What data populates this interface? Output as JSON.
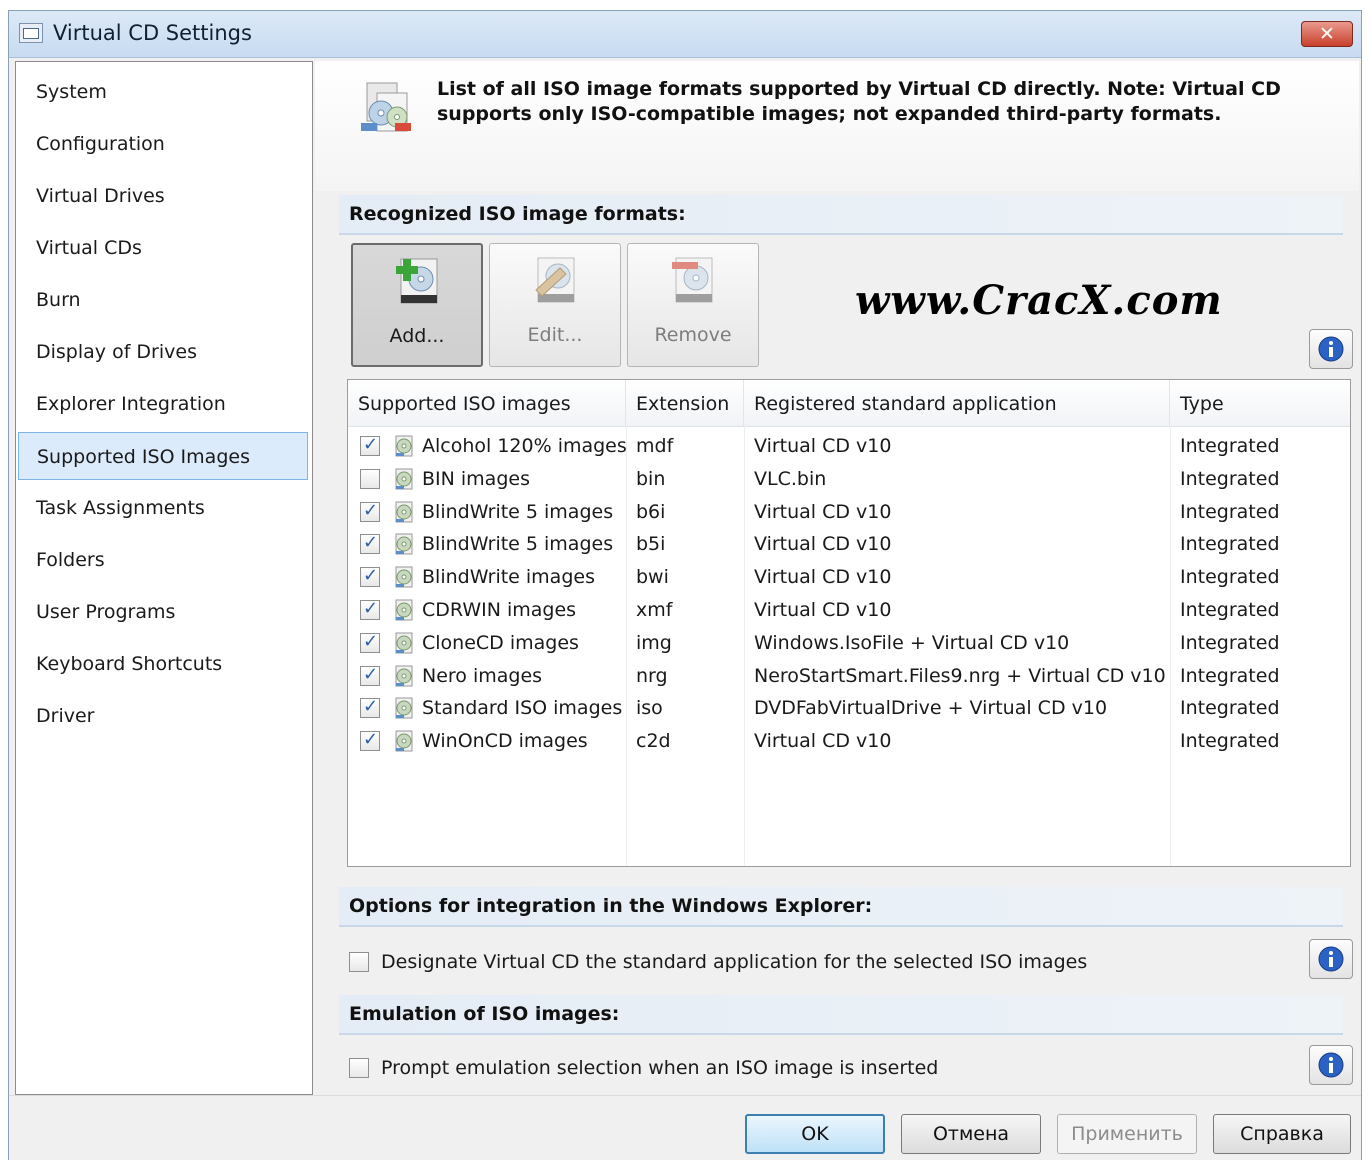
{
  "window": {
    "title": "Virtual CD Settings",
    "close_glyph": "✕"
  },
  "sidebar": {
    "items": [
      {
        "label": "System",
        "active": false
      },
      {
        "label": "Configuration",
        "active": false
      },
      {
        "label": "Virtual Drives",
        "active": false
      },
      {
        "label": "Virtual CDs",
        "active": false
      },
      {
        "label": "Burn",
        "active": false
      },
      {
        "label": "Display of Drives",
        "active": false
      },
      {
        "label": "Explorer Integration",
        "active": false
      },
      {
        "label": "Supported ISO Images",
        "active": true
      },
      {
        "label": "Task Assignments",
        "active": false
      },
      {
        "label": "Folders",
        "active": false
      },
      {
        "label": "User Programs",
        "active": false
      },
      {
        "label": "Keyboard Shortcuts",
        "active": false
      },
      {
        "label": "Driver",
        "active": false
      }
    ]
  },
  "banner": {
    "text": "List of all ISO image formats supported by Virtual CD directly. Note: Virtual CD supports only ISO-compatible images; not expanded third-party formats."
  },
  "recognized": {
    "header": "Recognized ISO image formats:",
    "buttons": {
      "add": "Add...",
      "edit": "Edit...",
      "remove": "Remove"
    },
    "watermark": "www.CracX.com",
    "columns": [
      "Supported ISO images",
      "Extension",
      "Registered standard application",
      "Type"
    ],
    "rows": [
      {
        "checked": true,
        "name": "Alcohol 120% images",
        "ext": "mdf",
        "app": "Virtual CD v10",
        "type": "Integrated"
      },
      {
        "checked": false,
        "name": "BIN images",
        "ext": "bin",
        "app": "VLC.bin",
        "type": "Integrated"
      },
      {
        "checked": true,
        "name": "BlindWrite 5 images",
        "ext": "b6i",
        "app": "Virtual CD v10",
        "type": "Integrated"
      },
      {
        "checked": true,
        "name": "BlindWrite 5 images",
        "ext": "b5i",
        "app": "Virtual CD v10",
        "type": "Integrated"
      },
      {
        "checked": true,
        "name": "BlindWrite images",
        "ext": "bwi",
        "app": "Virtual CD v10",
        "type": "Integrated"
      },
      {
        "checked": true,
        "name": "CDRWIN images",
        "ext": "xmf",
        "app": "Virtual CD v10",
        "type": "Integrated"
      },
      {
        "checked": true,
        "name": "CloneCD images",
        "ext": "img",
        "app": "Windows.IsoFile + Virtual CD v10",
        "type": "Integrated"
      },
      {
        "checked": true,
        "name": "Nero images",
        "ext": "nrg",
        "app": "NeroStartSmart.Files9.nrg + Virtual CD v10",
        "type": "Integrated"
      },
      {
        "checked": true,
        "name": "Standard ISO images",
        "ext": "iso",
        "app": "DVDFabVirtualDrive + Virtual CD v10",
        "type": "Integrated"
      },
      {
        "checked": true,
        "name": "WinOnCD images",
        "ext": "c2d",
        "app": "Virtual CD v10",
        "type": "Integrated"
      }
    ]
  },
  "explorer": {
    "header": "Options for integration in the Windows Explorer:",
    "option": "Designate Virtual CD the standard application for the selected ISO images",
    "checked": false
  },
  "emulation": {
    "header": "Emulation of ISO images:",
    "option": "Prompt emulation selection when an ISO image is inserted",
    "checked": false
  },
  "footer": {
    "ok": "OK",
    "cancel": "Отмена",
    "apply": "Применить",
    "help": "Справка"
  },
  "icons": {
    "info": "info-icon",
    "disc": "disc-icon"
  },
  "colors": {
    "accent": "#2d5fa8",
    "selected_bg": "#dcebfc",
    "close": "#c9402c"
  }
}
